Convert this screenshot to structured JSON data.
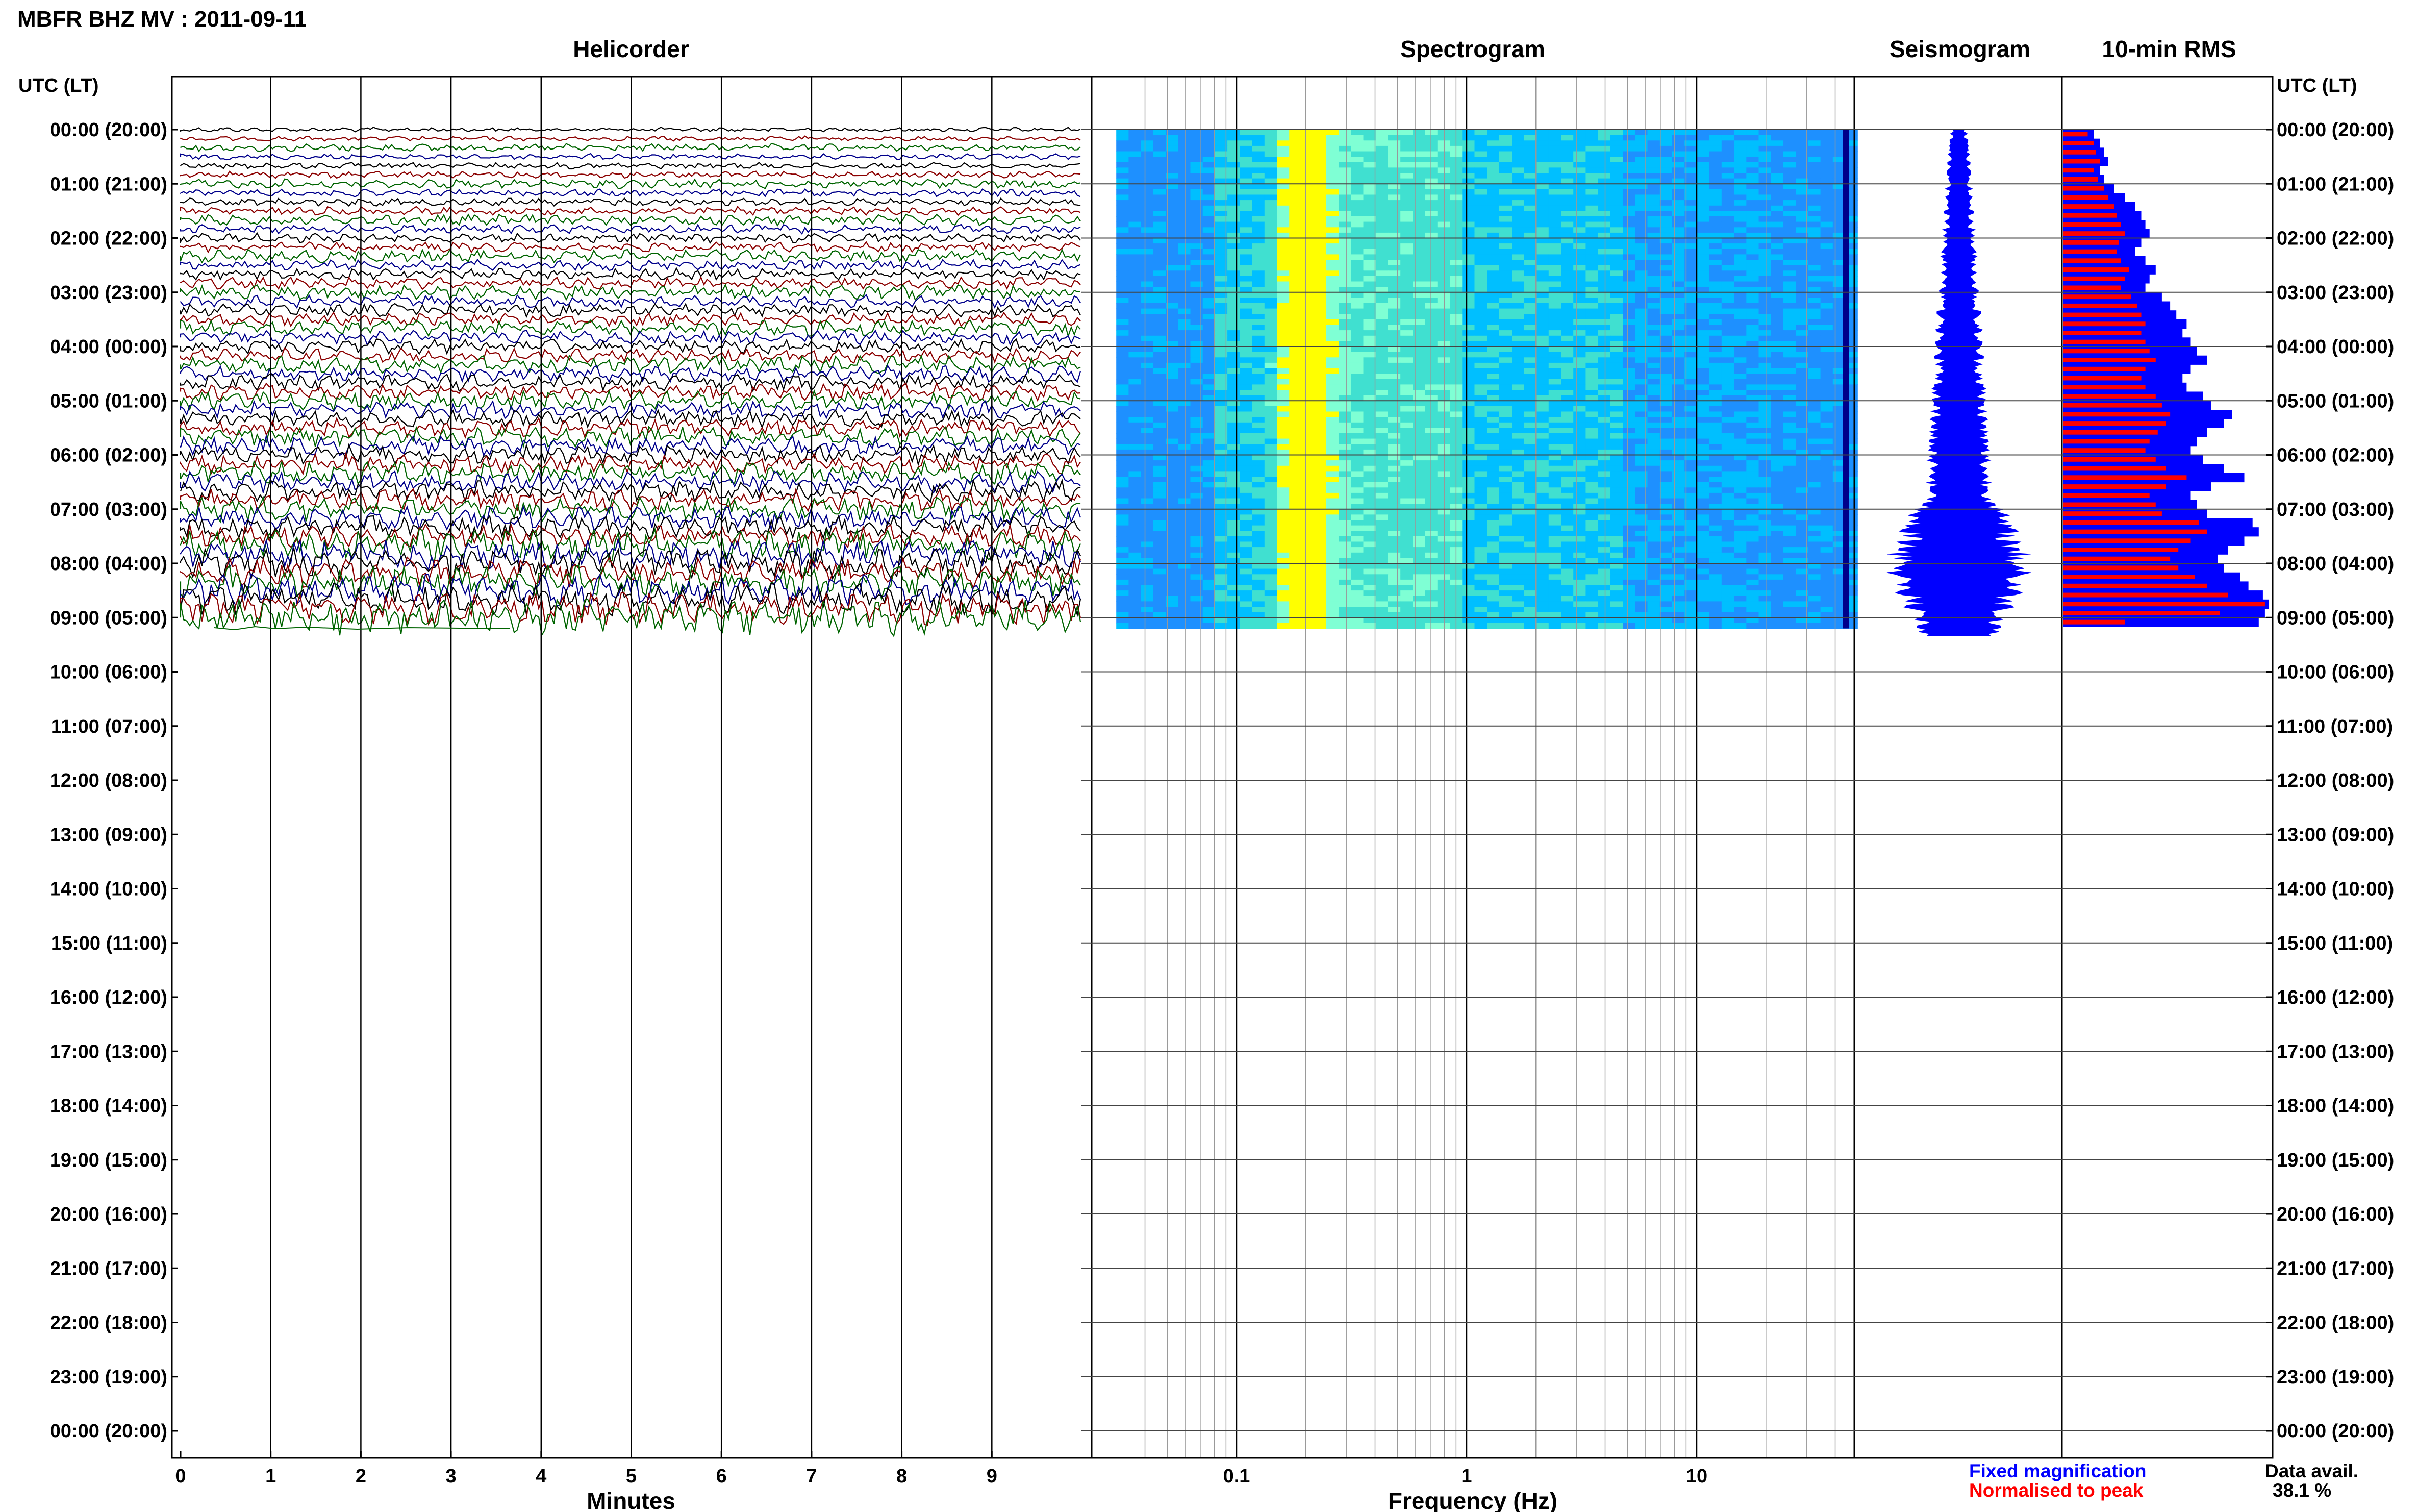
{
  "header": {
    "title": "MBFR BHZ MV : 2011-09-11"
  },
  "panels": {
    "helicorder": "Helicorder",
    "spectrogram": "Spectrogram",
    "seismogram": "Seismogram",
    "rms": "10-min RMS"
  },
  "axis": {
    "left_header": "UTC (LT)",
    "right_header": "UTC (LT)",
    "time_labels": [
      "00:00 (20:00)",
      "01:00 (21:00)",
      "02:00 (22:00)",
      "03:00 (23:00)",
      "04:00 (00:00)",
      "05:00 (01:00)",
      "06:00 (02:00)",
      "07:00 (03:00)",
      "08:00 (04:00)",
      "09:00 (05:00)",
      "10:00 (06:00)",
      "11:00 (07:00)",
      "12:00 (08:00)",
      "13:00 (09:00)",
      "14:00 (10:00)",
      "15:00 (11:00)",
      "16:00 (12:00)",
      "17:00 (13:00)",
      "18:00 (14:00)",
      "19:00 (15:00)",
      "20:00 (16:00)",
      "21:00 (17:00)",
      "22:00 (18:00)",
      "23:00 (19:00)",
      "00:00 (20:00)"
    ],
    "minutes_ticks": [
      "0",
      "1",
      "2",
      "3",
      "4",
      "5",
      "6",
      "7",
      "8",
      "9"
    ],
    "minutes_label": "Minutes",
    "freq_ticks": [
      "0.1",
      "1",
      "10"
    ],
    "freq_label": "Frequency (Hz)"
  },
  "legend": {
    "fixed": "Fixed magnification",
    "normalised": "Normalised to peak",
    "fixed_color": "#0000ff",
    "normalised_color": "#ff0000"
  },
  "availability": {
    "label": "Data avail.",
    "value": "38.1 %"
  },
  "colors": {
    "trace_cycle": [
      "#000000",
      "#8b0000",
      "#006400",
      "#00008b"
    ],
    "spectrogram_palette": [
      "#00008b",
      "#0000ff",
      "#1e90ff",
      "#00bfff",
      "#40e0d0",
      "#7fffd4",
      "#ffff00"
    ],
    "seismogram": "#0000ff"
  },
  "chart_data": [
    {
      "type": "line",
      "panel": "helicorder",
      "xlabel": "Minutes",
      "xlim": [
        0,
        10
      ],
      "rows_per_hour": 6,
      "data_hours": 9.2,
      "color_cycle": [
        "black",
        "darkred",
        "green",
        "darkblue"
      ]
    },
    {
      "type": "heatmap",
      "panel": "spectrogram",
      "xlabel": "Frequency (Hz)",
      "xscale": "log",
      "xlim": [
        0.03,
        50
      ],
      "data_hours": 9.2,
      "peak_band_hz": 0.2
    },
    {
      "type": "area",
      "panel": "seismogram",
      "data_hours": 9.2
    },
    {
      "type": "bar",
      "panel": "10-min RMS",
      "orientation": "horizontal",
      "interval_min": 10,
      "series": [
        {
          "name": "Fixed magnification",
          "color": "#0000ff",
          "values": [
            0.15,
            0.18,
            0.2,
            0.22,
            0.18,
            0.2,
            0.25,
            0.3,
            0.35,
            0.38,
            0.4,
            0.42,
            0.38,
            0.35,
            0.4,
            0.45,
            0.42,
            0.4,
            0.48,
            0.52,
            0.55,
            0.6,
            0.58,
            0.62,
            0.65,
            0.7,
            0.62,
            0.58,
            0.6,
            0.68,
            0.72,
            0.82,
            0.78,
            0.7,
            0.65,
            0.62,
            0.68,
            0.78,
            0.88,
            0.72,
            0.62,
            0.65,
            0.7,
            0.92,
            0.95,
            0.88,
            0.8,
            0.75,
            0.78,
            0.86,
            0.9,
            0.97,
            1.0,
            0.98,
            0.95
          ]
        },
        {
          "name": "Normalised to peak",
          "color": "#ff0000",
          "values": [
            0.12,
            0.15,
            0.16,
            0.18,
            0.15,
            0.17,
            0.2,
            0.22,
            0.25,
            0.26,
            0.28,
            0.3,
            0.27,
            0.26,
            0.28,
            0.32,
            0.3,
            0.28,
            0.33,
            0.36,
            0.38,
            0.4,
            0.38,
            0.4,
            0.42,
            0.45,
            0.4,
            0.38,
            0.4,
            0.45,
            0.48,
            0.52,
            0.5,
            0.46,
            0.42,
            0.4,
            0.45,
            0.5,
            0.6,
            0.5,
            0.42,
            0.45,
            0.48,
            0.66,
            0.7,
            0.62,
            0.56,
            0.52,
            0.56,
            0.64,
            0.7,
            0.8,
            0.98,
            0.76,
            0.3
          ]
        }
      ]
    }
  ]
}
